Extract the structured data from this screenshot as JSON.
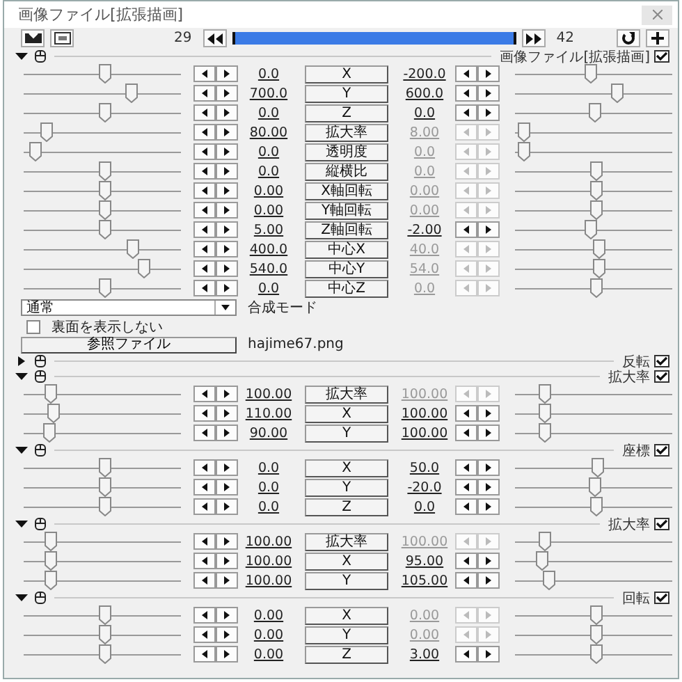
{
  "window": {
    "title": "画像ファイル[拡張描画]"
  },
  "toolbar": {
    "start_frame": "29",
    "end_frame": "42"
  },
  "sections": [
    {
      "label": "画像ファイル[拡張描画]",
      "expanded": true,
      "enabled": true,
      "tracks": [
        {
          "name": "X",
          "start": "0.0",
          "end": "-200.0",
          "end_disabled": false,
          "start_slider": {
            "level": 0.51
          },
          "end_slider": {
            "level": 0.48
          }
        },
        {
          "name": "Y",
          "start": "700.0",
          "end": "600.0",
          "end_disabled": false,
          "start_slider": {
            "level": 0.68
          },
          "end_slider": {
            "level": 0.65
          }
        },
        {
          "name": "Z",
          "start": "0.0",
          "end": "0.0",
          "end_disabled": false,
          "start_slider": {
            "level": 0.51
          },
          "end_slider": {
            "level": 0.5
          }
        },
        {
          "name": "拡大率",
          "start": "80.00",
          "end": "8.00",
          "end_disabled": true,
          "start_slider": {
            "level": 0.14
          },
          "end_slider": {
            "level": 0.05
          }
        },
        {
          "name": "透明度",
          "start": "0.0",
          "end": "0.0",
          "end_disabled": true,
          "start_slider": {
            "level": 0.07
          },
          "end_slider": {
            "level": 0.05
          }
        },
        {
          "name": "縦横比",
          "start": "0.0",
          "end": "0.0",
          "end_disabled": true,
          "start_slider": {
            "level": 0.51
          },
          "end_slider": {
            "level": 0.51
          }
        },
        {
          "name": "X軸回転",
          "start": "0.00",
          "end": "0.00",
          "end_disabled": true,
          "start_slider": {
            "level": 0.51
          },
          "end_slider": {
            "level": 0.51
          }
        },
        {
          "name": "Y軸回転",
          "start": "0.00",
          "end": "0.00",
          "end_disabled": true,
          "start_slider": {
            "level": 0.51
          },
          "end_slider": {
            "level": 0.51
          }
        },
        {
          "name": "Z軸回転",
          "start": "5.00",
          "end": "-2.00",
          "end_disabled": false,
          "start_slider": {
            "level": 0.51
          },
          "end_slider": {
            "level": 0.48
          }
        },
        {
          "name": "中心X",
          "start": "400.0",
          "end": "40.0",
          "end_disabled": true,
          "start_slider": {
            "level": 0.69
          },
          "end_slider": {
            "level": 0.53
          }
        },
        {
          "name": "中心Y",
          "start": "540.0",
          "end": "54.0",
          "end_disabled": true,
          "start_slider": {
            "level": 0.76
          },
          "end_slider": {
            "level": 0.53
          }
        },
        {
          "name": "中心Z",
          "start": "0.0",
          "end": "0.0",
          "end_disabled": true,
          "start_slider": {
            "level": 0.51
          },
          "end_slider": {
            "level": 0.51
          }
        }
      ],
      "blend_mode": {
        "value": "通常",
        "label": "合成モード"
      },
      "backface": {
        "label": "裏面を表示しない",
        "checked": false
      },
      "source_file": {
        "button": "参照ファイル",
        "name": "hajime67.png"
      }
    },
    {
      "label": "反転",
      "expanded": false,
      "enabled": true
    },
    {
      "label": "拡大率",
      "expanded": true,
      "enabled": true,
      "tracks": [
        {
          "name": "拡大率",
          "start": "100.00",
          "end": "100.00",
          "end_disabled": true,
          "start_slider": {
            "level": 0.17
          },
          "end_slider": {
            "level": 0.19
          }
        },
        {
          "name": "X",
          "start": "110.00",
          "end": "100.00",
          "end_disabled": false,
          "start_slider": {
            "level": 0.19
          },
          "end_slider": {
            "level": 0.19
          }
        },
        {
          "name": "Y",
          "start": "90.00",
          "end": "100.00",
          "end_disabled": false,
          "start_slider": {
            "level": 0.16
          },
          "end_slider": {
            "level": 0.19
          }
        }
      ]
    },
    {
      "label": "座標",
      "expanded": true,
      "enabled": true,
      "tracks": [
        {
          "name": "X",
          "start": "0.0",
          "end": "50.0",
          "end_disabled": false,
          "start_slider": {
            "level": 0.51
          },
          "end_slider": {
            "level": 0.52
          }
        },
        {
          "name": "Y",
          "start": "0.0",
          "end": "-20.0",
          "end_disabled": false,
          "start_slider": {
            "level": 0.51
          },
          "end_slider": {
            "level": 0.5
          }
        },
        {
          "name": "Z",
          "start": "0.0",
          "end": "0.0",
          "end_disabled": false,
          "start_slider": {
            "level": 0.51
          },
          "end_slider": {
            "level": 0.51
          }
        }
      ]
    },
    {
      "label": "拡大率",
      "expanded": true,
      "enabled": true,
      "tracks": [
        {
          "name": "拡大率",
          "start": "100.00",
          "end": "100.00",
          "end_disabled": true,
          "start_slider": {
            "level": 0.17
          },
          "end_slider": {
            "level": 0.19
          }
        },
        {
          "name": "X",
          "start": "100.00",
          "end": "95.00",
          "end_disabled": false,
          "start_slider": {
            "level": 0.17
          },
          "end_slider": {
            "level": 0.17
          }
        },
        {
          "name": "Y",
          "start": "100.00",
          "end": "105.00",
          "end_disabled": false,
          "start_slider": {
            "level": 0.17
          },
          "end_slider": {
            "level": 0.21
          }
        }
      ]
    },
    {
      "label": "回転",
      "expanded": true,
      "enabled": true,
      "tracks": [
        {
          "name": "X",
          "start": "0.00",
          "end": "0.00",
          "end_disabled": true,
          "start_slider": {
            "level": 0.51
          },
          "end_slider": {
            "level": 0.51
          }
        },
        {
          "name": "Y",
          "start": "0.00",
          "end": "0.00",
          "end_disabled": true,
          "start_slider": {
            "level": 0.51
          },
          "end_slider": {
            "level": 0.51
          }
        },
        {
          "name": "Z",
          "start": "0.00",
          "end": "3.00",
          "end_disabled": false,
          "start_slider": {
            "level": 0.51
          },
          "end_slider": {
            "level": 0.51
          }
        }
      ]
    }
  ]
}
